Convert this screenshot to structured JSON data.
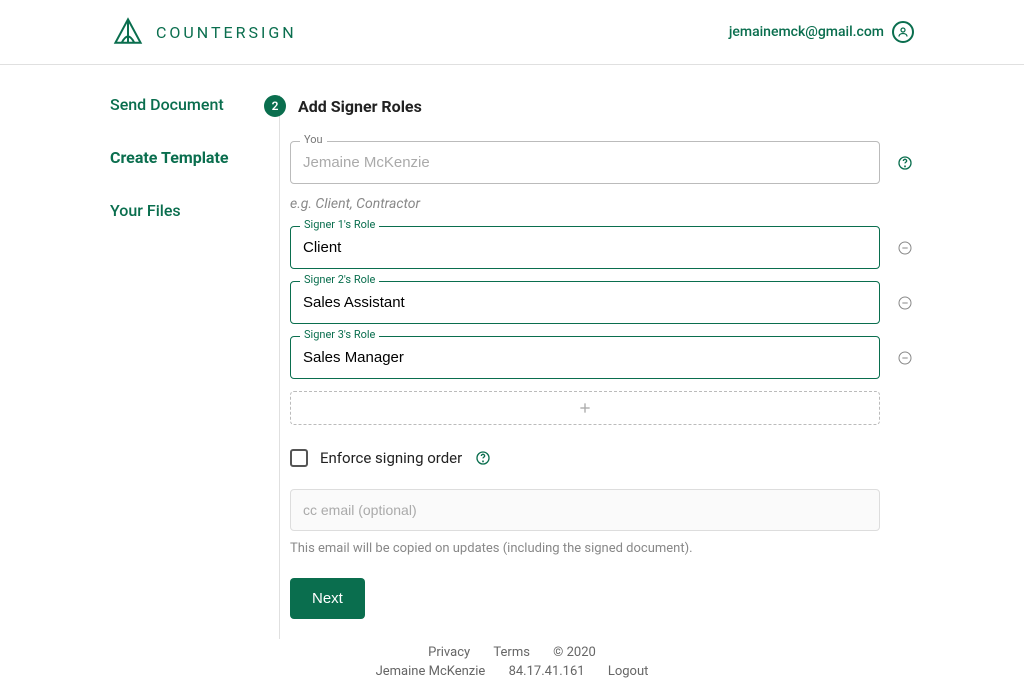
{
  "brand": {
    "name": "COUNTERSIGN"
  },
  "user": {
    "email": "jemainemck@gmail.com",
    "display_name": "Jemaine McKenzie"
  },
  "sidebar": {
    "items": [
      {
        "label": "Send Document"
      },
      {
        "label": "Create Template"
      },
      {
        "label": "Your Files"
      }
    ],
    "active_index": 1
  },
  "step": {
    "number": "2",
    "title": "Add Signer Roles"
  },
  "you_field": {
    "label": "You",
    "value": "Jemaine McKenzie"
  },
  "roles_hint": "e.g. Client, Contractor",
  "signers": [
    {
      "label": "Signer 1's Role",
      "value": "Client"
    },
    {
      "label": "Signer 2's Role",
      "value": "Sales Assistant"
    },
    {
      "label": "Signer 3's Role",
      "value": "Sales Manager"
    }
  ],
  "enforce_order": {
    "label": "Enforce signing order",
    "checked": false
  },
  "cc": {
    "placeholder": "cc email (optional)",
    "value": "",
    "hint": "This email will be copied on updates (including the signed document)."
  },
  "next_label": "Next",
  "footer": {
    "privacy": "Privacy",
    "terms": "Terms",
    "copyright": "© 2020",
    "user_name": "Jemaine McKenzie",
    "ip": "84.17.41.161",
    "logout": "Logout"
  }
}
